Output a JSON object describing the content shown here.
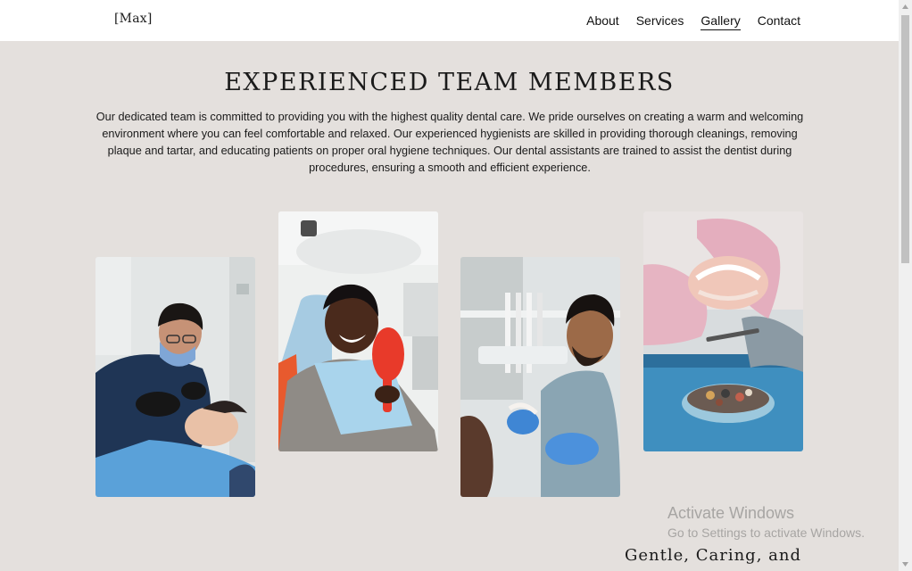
{
  "header": {
    "logo": "[Max]",
    "nav": [
      {
        "label": "About",
        "active": false
      },
      {
        "label": "Services",
        "active": false
      },
      {
        "label": "Gallery",
        "active": true
      },
      {
        "label": "Contact",
        "active": false
      }
    ]
  },
  "main": {
    "title": "EXPERIENCED TEAM MEMBERS",
    "intro": "Our dedicated team is committed to providing you with the highest quality dental care. We pride ourselves on creating a warm and welcoming environment where you can feel comfortable and relaxed. Our experienced hygienists are skilled in providing thorough cleanings, removing plaque and tartar, and educating patients on proper oral hygiene techniques. Our dental assistants are trained to assist the dentist during procedures, ensuring a smooth and efficient experience.",
    "next_section_title": "Gentle, Caring, and"
  },
  "watermark": {
    "title": "Activate Windows",
    "subtitle": "Go to Settings to activate Windows."
  },
  "colors": {
    "page_background": "#e4e0dd",
    "header_background": "#ffffff",
    "text": "#1a1a1a",
    "watermark": "#a7a5a3"
  }
}
